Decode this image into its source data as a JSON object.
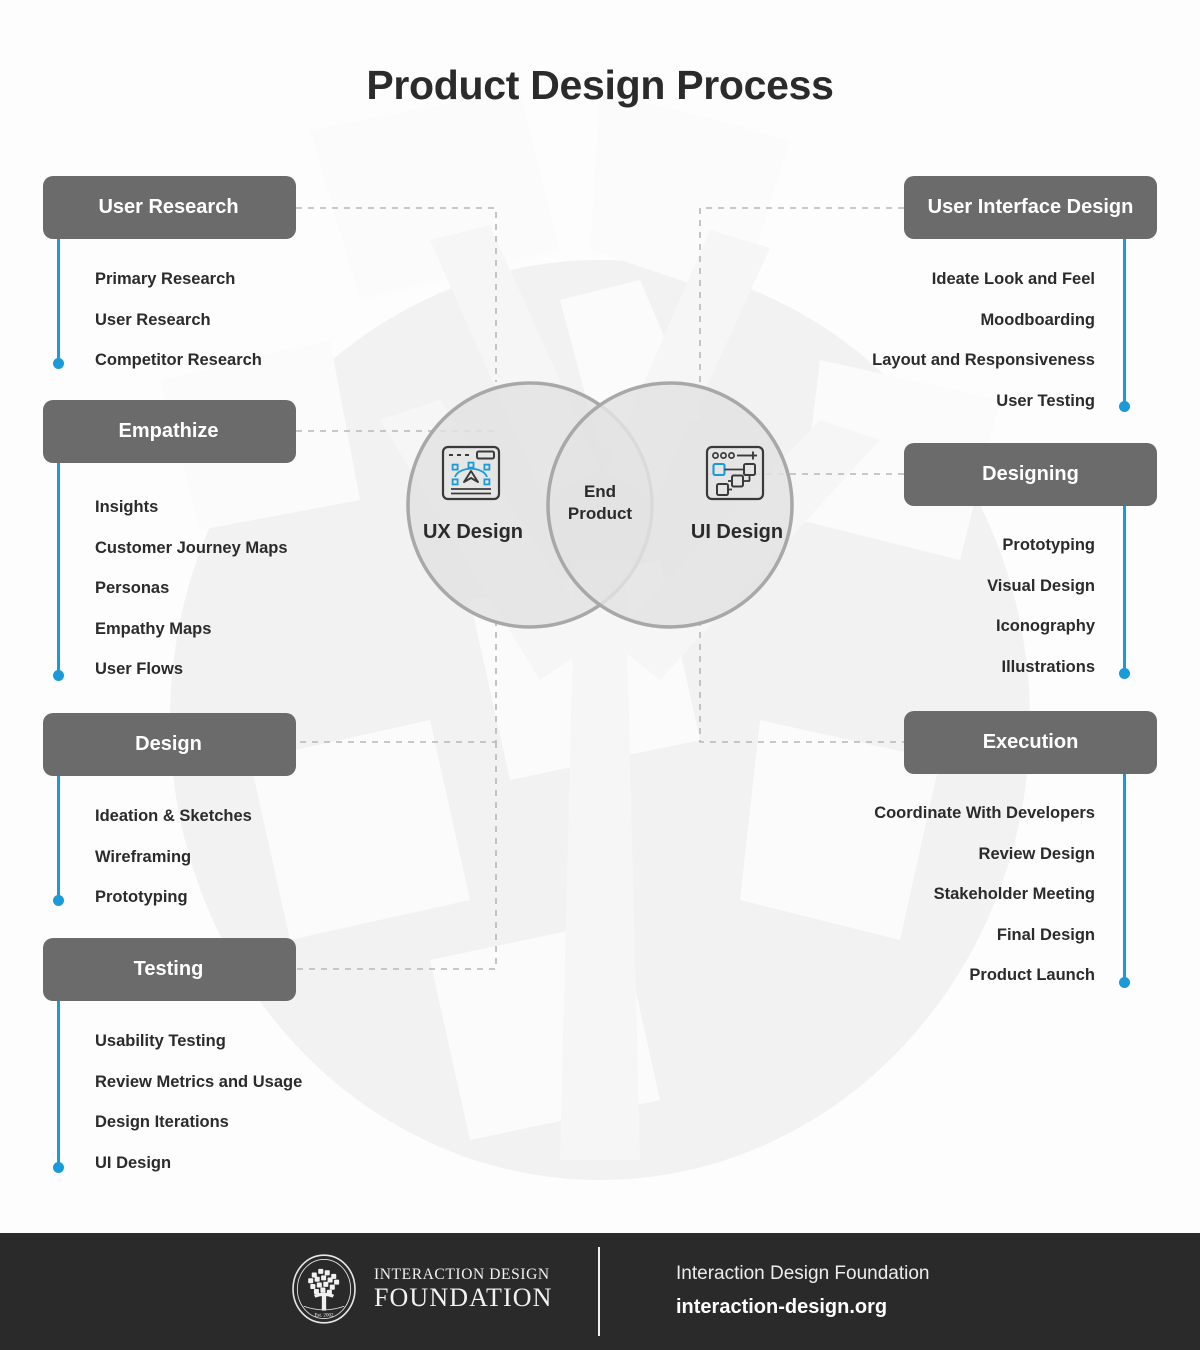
{
  "title": "Product Design Process",
  "colors": {
    "pill_bg": "#6b6b6b",
    "accent_blue": "#1a9ad7",
    "text_dark": "#2b2b2b",
    "footer_bg": "#2a2a2a",
    "dashed_gray": "#b5b5b5",
    "circle_fill": "#e4e4e4",
    "circle_stroke": "#a8a8a8"
  },
  "left_sections": [
    {
      "heading": "User Research",
      "items": [
        "Primary Research",
        "User Research",
        "Competitor Research"
      ]
    },
    {
      "heading": "Empathize",
      "items": [
        "Insights",
        "Customer Journey Maps",
        "Personas",
        "Empathy Maps",
        "User Flows"
      ]
    },
    {
      "heading": "Design",
      "items": [
        "Ideation & Sketches",
        "Wireframing",
        "Prototyping"
      ]
    },
    {
      "heading": "Testing",
      "items": [
        "Usability Testing",
        "Review Metrics and Usage",
        "Design Iterations",
        "UI Design"
      ]
    }
  ],
  "right_sections": [
    {
      "heading": "User Interface Design",
      "items": [
        "Ideate Look and Feel",
        "Moodboarding",
        "Layout and Responsiveness",
        "User Testing"
      ]
    },
    {
      "heading": "Designing",
      "items": [
        "Prototyping",
        "Visual Design",
        "Iconography",
        "Illustrations"
      ]
    },
    {
      "heading": "Execution",
      "items": [
        "Coordinate With Developers",
        "Review Design",
        "Stakeholder Meeting",
        "Final Design",
        "Product  Launch"
      ]
    }
  ],
  "venn": {
    "left_label": "UX Design",
    "right_label": "UI Design",
    "center_label": "End\nProduct",
    "center_line1": "End",
    "center_line2": "Product",
    "left_icon": "ux-design-icon",
    "right_icon": "ui-design-icon"
  },
  "footer": {
    "logo_line1": "INTERACTION DESIGN",
    "logo_line2": "FOUNDATION",
    "seal_text": "INTERACTION DESIGN FOUNDATION",
    "seal_est": "Est. 2002",
    "org_name": "Interaction Design Foundation",
    "url": "interaction-design.org"
  }
}
